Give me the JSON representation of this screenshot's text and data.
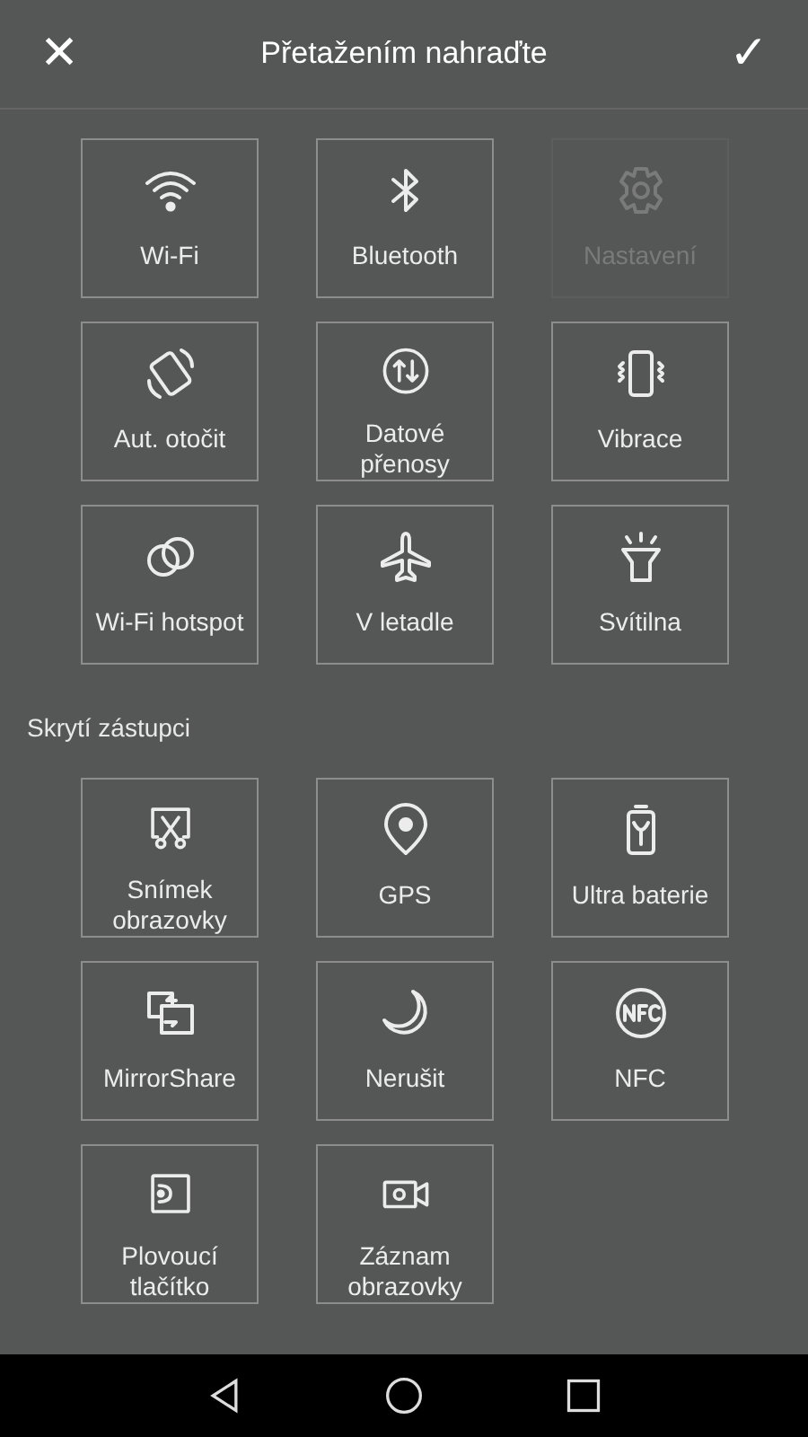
{
  "header": {
    "close": "✕",
    "title": "Přetažením nahraďte",
    "confirm": "✓"
  },
  "active_tiles": [
    {
      "kind": "wifi",
      "label": "Wi-Fi",
      "disabled": false
    },
    {
      "kind": "bluetooth",
      "label": "Bluetooth",
      "disabled": false
    },
    {
      "kind": "gear",
      "label": "Nastavení",
      "disabled": true
    },
    {
      "kind": "rotate",
      "label": "Aut. otočit",
      "disabled": false
    },
    {
      "kind": "data",
      "label": "Datové přenosy",
      "disabled": false
    },
    {
      "kind": "vibrate",
      "label": "Vibrace",
      "disabled": false
    },
    {
      "kind": "hotspot",
      "label": "Wi-Fi hotspot",
      "disabled": false
    },
    {
      "kind": "plane",
      "label": "V letadle",
      "disabled": false
    },
    {
      "kind": "torch",
      "label": "Svítilna",
      "disabled": false
    }
  ],
  "hidden_section": {
    "title": "Skrytí zástupci"
  },
  "hidden_tiles": [
    {
      "kind": "scissors",
      "label": "Snímek obrazovky",
      "disabled": false
    },
    {
      "kind": "pin",
      "label": "GPS",
      "disabled": false
    },
    {
      "kind": "battery",
      "label": "Ultra baterie",
      "disabled": false
    },
    {
      "kind": "mirror",
      "label": "MirrorShare",
      "disabled": false
    },
    {
      "kind": "moon",
      "label": "Nerušit",
      "disabled": false
    },
    {
      "kind": "nfc",
      "label": "NFC",
      "disabled": false
    },
    {
      "kind": "float",
      "label": "Plovoucí tlačítko",
      "disabled": false
    },
    {
      "kind": "camera",
      "label": "Záznam obrazovky",
      "disabled": false
    }
  ]
}
